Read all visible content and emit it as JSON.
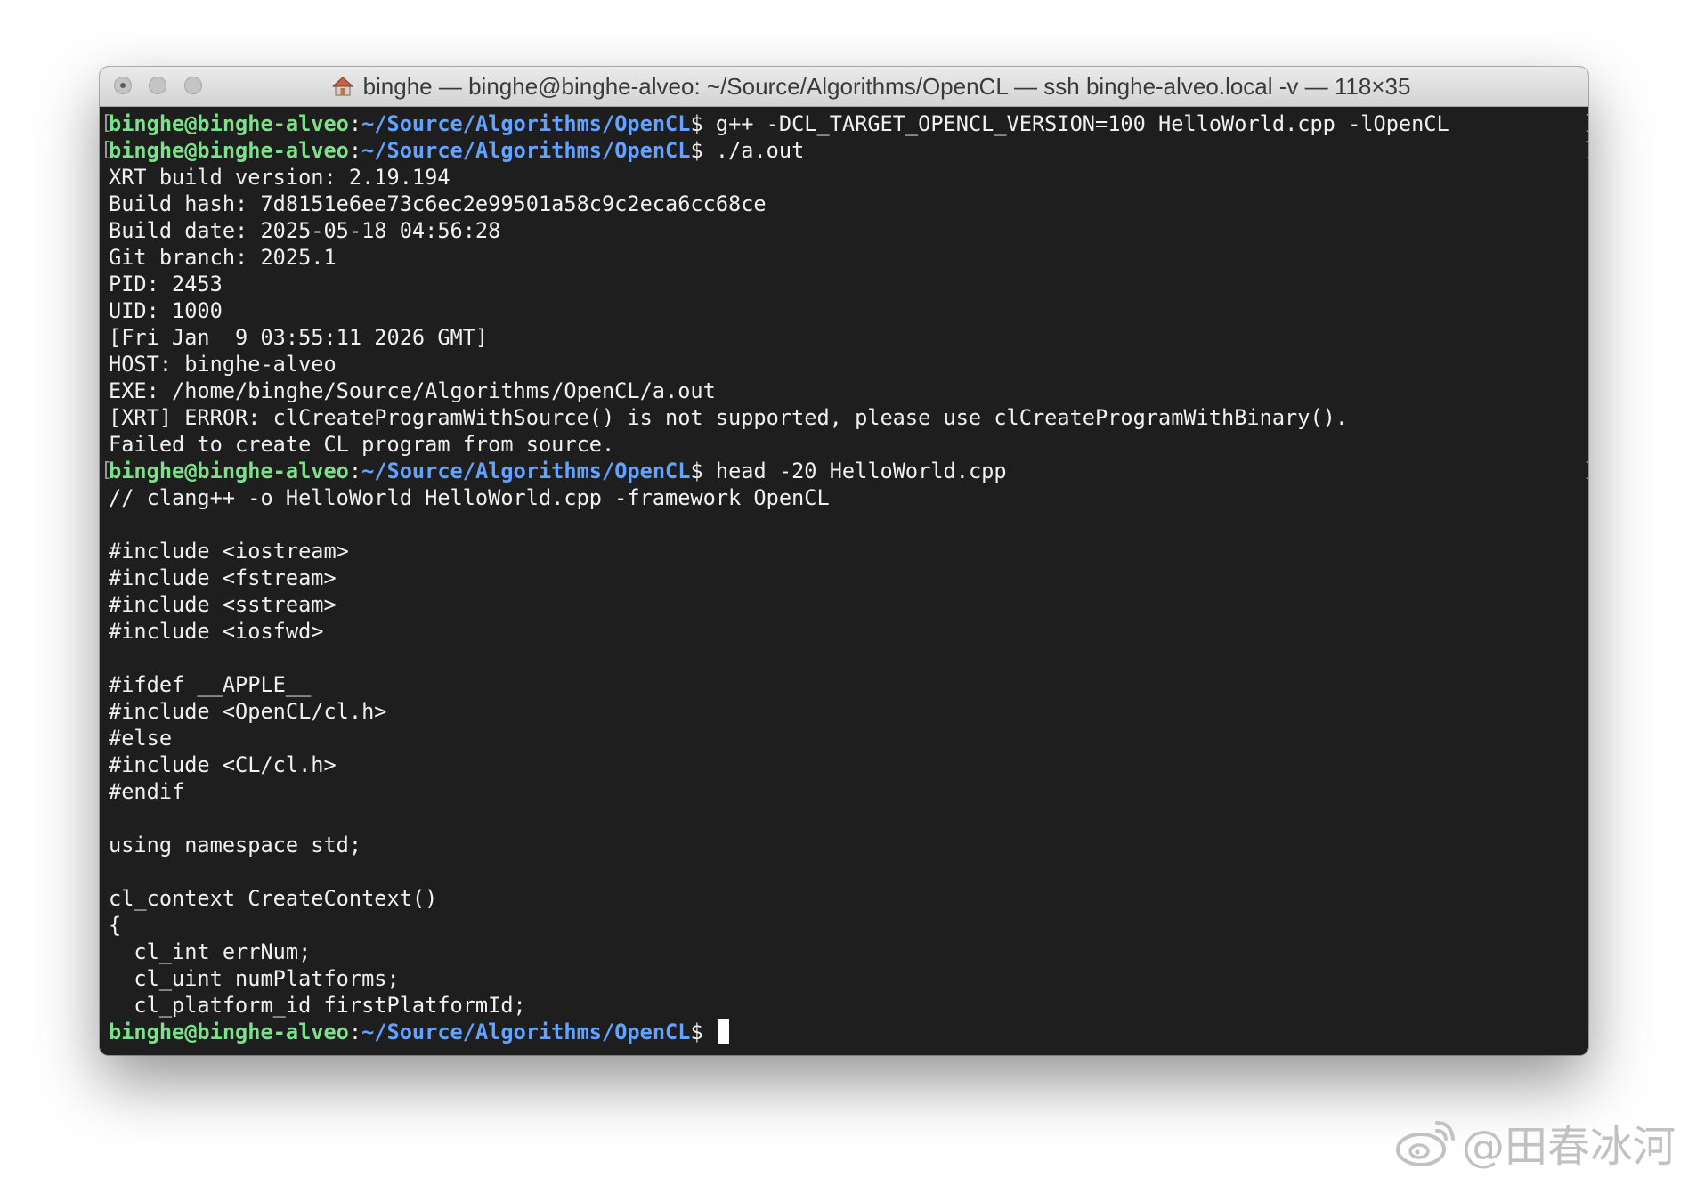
{
  "window": {
    "title": "binghe — binghe@binghe-alveo: ~/Source/Algorithms/OpenCL — ssh binghe-alveo.local -v — 118×35",
    "title_icon": "home-icon"
  },
  "terminal": {
    "colors": {
      "background": "#1e1e1e",
      "text": "#f0f0f0",
      "prompt_user": "#7ee08a",
      "prompt_path": "#63a2ff"
    },
    "lines": [
      {
        "type": "prompt",
        "user": "binghe@binghe-alveo",
        "path": "~/Source/Algorithms/OpenCL",
        "symbol": "$ ",
        "cmd": "g++ -DCL_TARGET_OPENCL_VERSION=100 HelloWorld.cpp -lOpenCL",
        "marked": true
      },
      {
        "type": "prompt",
        "user": "binghe@binghe-alveo",
        "path": "~/Source/Algorithms/OpenCL",
        "symbol": "$ ",
        "cmd": "./a.out",
        "marked": true
      },
      {
        "type": "output",
        "text": "XRT build version: 2.19.194"
      },
      {
        "type": "output",
        "text": "Build hash: 7d8151e6ee73c6ec2e99501a58c9c2eca6cc68ce"
      },
      {
        "type": "output",
        "text": "Build date: 2025-05-18 04:56:28"
      },
      {
        "type": "output",
        "text": "Git branch: 2025.1"
      },
      {
        "type": "output",
        "text": "PID: 2453"
      },
      {
        "type": "output",
        "text": "UID: 1000"
      },
      {
        "type": "output",
        "text": "[Fri Jan  9 03:55:11 2026 GMT]"
      },
      {
        "type": "output",
        "text": "HOST: binghe-alveo"
      },
      {
        "type": "output",
        "text": "EXE: /home/binghe/Source/Algorithms/OpenCL/a.out"
      },
      {
        "type": "output",
        "text": "[XRT] ERROR: clCreateProgramWithSource() is not supported, please use clCreateProgramWithBinary()."
      },
      {
        "type": "output",
        "text": "Failed to create CL program from source."
      },
      {
        "type": "prompt",
        "user": "binghe@binghe-alveo",
        "path": "~/Source/Algorithms/OpenCL",
        "symbol": "$ ",
        "cmd": "head -20 HelloWorld.cpp",
        "marked": true
      },
      {
        "type": "output",
        "text": "// clang++ -o HelloWorld HelloWorld.cpp -framework OpenCL"
      },
      {
        "type": "output",
        "text": ""
      },
      {
        "type": "output",
        "text": "#include <iostream>"
      },
      {
        "type": "output",
        "text": "#include <fstream>"
      },
      {
        "type": "output",
        "text": "#include <sstream>"
      },
      {
        "type": "output",
        "text": "#include <iosfwd>"
      },
      {
        "type": "output",
        "text": ""
      },
      {
        "type": "output",
        "text": "#ifdef __APPLE__"
      },
      {
        "type": "output",
        "text": "#include <OpenCL/cl.h>"
      },
      {
        "type": "output",
        "text": "#else"
      },
      {
        "type": "output",
        "text": "#include <CL/cl.h>"
      },
      {
        "type": "output",
        "text": "#endif"
      },
      {
        "type": "output",
        "text": ""
      },
      {
        "type": "output",
        "text": "using namespace std;"
      },
      {
        "type": "output",
        "text": ""
      },
      {
        "type": "output",
        "text": "cl_context CreateContext()"
      },
      {
        "type": "output",
        "text": "{"
      },
      {
        "type": "output",
        "text": "  cl_int errNum;"
      },
      {
        "type": "output",
        "text": "  cl_uint numPlatforms;"
      },
      {
        "type": "output",
        "text": "  cl_platform_id firstPlatformId;"
      },
      {
        "type": "prompt",
        "user": "binghe@binghe-alveo",
        "path": "~/Source/Algorithms/OpenCL",
        "symbol": "$ ",
        "cmd": "",
        "cursor": true,
        "marked": false
      }
    ]
  },
  "watermark": {
    "text": "@田春冰河",
    "icon": "weibo-icon"
  }
}
